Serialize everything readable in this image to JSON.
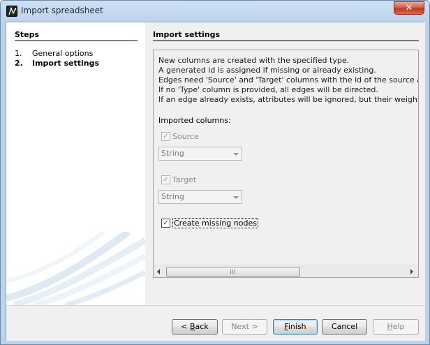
{
  "window": {
    "title": "Import spreadsheet",
    "close_glyph": "✕",
    "app_icon": "gephi-icon"
  },
  "sidebar": {
    "heading": "Steps",
    "steps": [
      {
        "num": "1.",
        "label": "General options",
        "active": false
      },
      {
        "num": "2.",
        "label": "Import settings",
        "active": true
      }
    ]
  },
  "main": {
    "heading": "Import settings",
    "info_lines": [
      "New columns are created with the specified type.",
      "A generated id is assigned if missing or already existing.",
      "Edges need 'Source' and 'Target' columns with the id of the source and target",
      "If no 'Type' column is provided, all edges will be directed.",
      "If an edge already exists, attributes will be ignored, but their weights will be a"
    ],
    "imported_label": "Imported columns:",
    "columns": [
      {
        "name": "Source",
        "checked": true,
        "enabled": false,
        "type": "String"
      },
      {
        "name": "Target",
        "checked": true,
        "enabled": false,
        "type": "String"
      }
    ],
    "create_missing": {
      "label": "Create missing nodes",
      "checked": true
    }
  },
  "buttons": {
    "back": {
      "prefix": "< ",
      "mnemonic": "B",
      "rest": "ack",
      "enabled": true
    },
    "next": {
      "label": "Next >",
      "enabled": false
    },
    "finish": {
      "mnemonic": "F",
      "rest": "inish",
      "enabled": true
    },
    "cancel": {
      "label": "Cancel",
      "enabled": true
    },
    "help": {
      "mnemonic": "H",
      "rest": "elp",
      "enabled": false
    }
  },
  "colors": {
    "titlebar": "#bcd3ea",
    "close_button": "#c3361f",
    "default_button_border": "#3c7fb1"
  }
}
